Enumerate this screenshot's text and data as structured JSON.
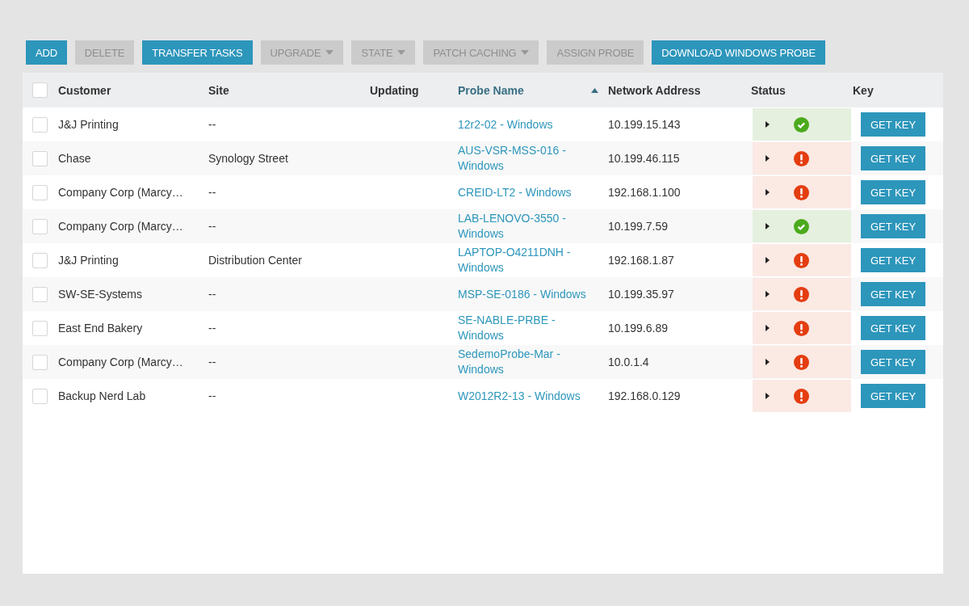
{
  "toolbar": [
    {
      "label": "ADD",
      "disabled": false,
      "dropdown": false
    },
    {
      "label": "DELETE",
      "disabled": true,
      "dropdown": false
    },
    {
      "label": "TRANSFER TASKS",
      "disabled": false,
      "dropdown": false
    },
    {
      "label": "UPGRADE",
      "disabled": true,
      "dropdown": true
    },
    {
      "label": "STATE",
      "disabled": true,
      "dropdown": true
    },
    {
      "label": "PATCH CACHING",
      "disabled": true,
      "dropdown": true
    },
    {
      "label": "ASSIGN PROBE",
      "disabled": true,
      "dropdown": false
    },
    {
      "label": "DOWNLOAD WINDOWS PROBE",
      "disabled": false,
      "dropdown": false
    }
  ],
  "table": {
    "select_all": {
      "checked": false
    },
    "columns": [
      {
        "label": "Customer",
        "sorted": false
      },
      {
        "label": "Site",
        "sorted": false
      },
      {
        "label": "Updating",
        "sorted": false
      },
      {
        "label": "Probe Name",
        "sorted": true
      },
      {
        "label": "Network Address",
        "sorted": false
      },
      {
        "label": "Status",
        "sorted": false
      },
      {
        "label": "Key",
        "sorted": false
      }
    ],
    "rows": [
      {
        "checked": false,
        "customer": "J&J Printing",
        "site": "--",
        "probe_name": "12r2-02 - Windows",
        "network_address": "10.199.15.143",
        "ok": true,
        "key_button": "GET KEY"
      },
      {
        "checked": false,
        "customer": "Chase",
        "site": "Synology Street",
        "probe_name": "AUS-VSR-MSS-016 - Windows",
        "network_address": "10.199.46.115",
        "ok": false,
        "key_button": "GET KEY"
      },
      {
        "checked": false,
        "customer": "Company Corp (Marcy…",
        "site": "--",
        "probe_name": "CREID-LT2 - Windows",
        "network_address": "192.168.1.100",
        "ok": false,
        "key_button": "GET KEY"
      },
      {
        "checked": false,
        "customer": "Company Corp (Marcy…",
        "site": "--",
        "probe_name": "LAB-LENOVO-3550 - Windows",
        "network_address": "10.199.7.59",
        "ok": true,
        "key_button": "GET KEY"
      },
      {
        "checked": false,
        "customer": "J&J Printing",
        "site": "Distribution Center",
        "probe_name": "LAPTOP-O4211DNH - Windows",
        "network_address": "192.168.1.87",
        "ok": false,
        "key_button": "GET KEY"
      },
      {
        "checked": false,
        "customer": "SW-SE-Systems",
        "site": "--",
        "probe_name": "MSP-SE-0186 - Windows",
        "network_address": "10.199.35.97",
        "ok": false,
        "key_button": "GET KEY"
      },
      {
        "checked": false,
        "customer": "East End Bakery",
        "site": "--",
        "probe_name": "SE-NABLE-PRBE - Windows",
        "network_address": "10.199.6.89",
        "ok": false,
        "key_button": "GET KEY"
      },
      {
        "checked": false,
        "customer": "Company Corp (Marcy…",
        "site": "--",
        "probe_name": "SedemoProbe-Mar - Windows",
        "network_address": "10.0.1.4",
        "ok": false,
        "key_button": "GET KEY"
      },
      {
        "checked": false,
        "customer": "Backup Nerd Lab",
        "site": "--",
        "probe_name": "W2012R2-13 - Windows",
        "network_address": "192.168.0.129",
        "ok": false,
        "key_button": "GET KEY"
      }
    ]
  }
}
